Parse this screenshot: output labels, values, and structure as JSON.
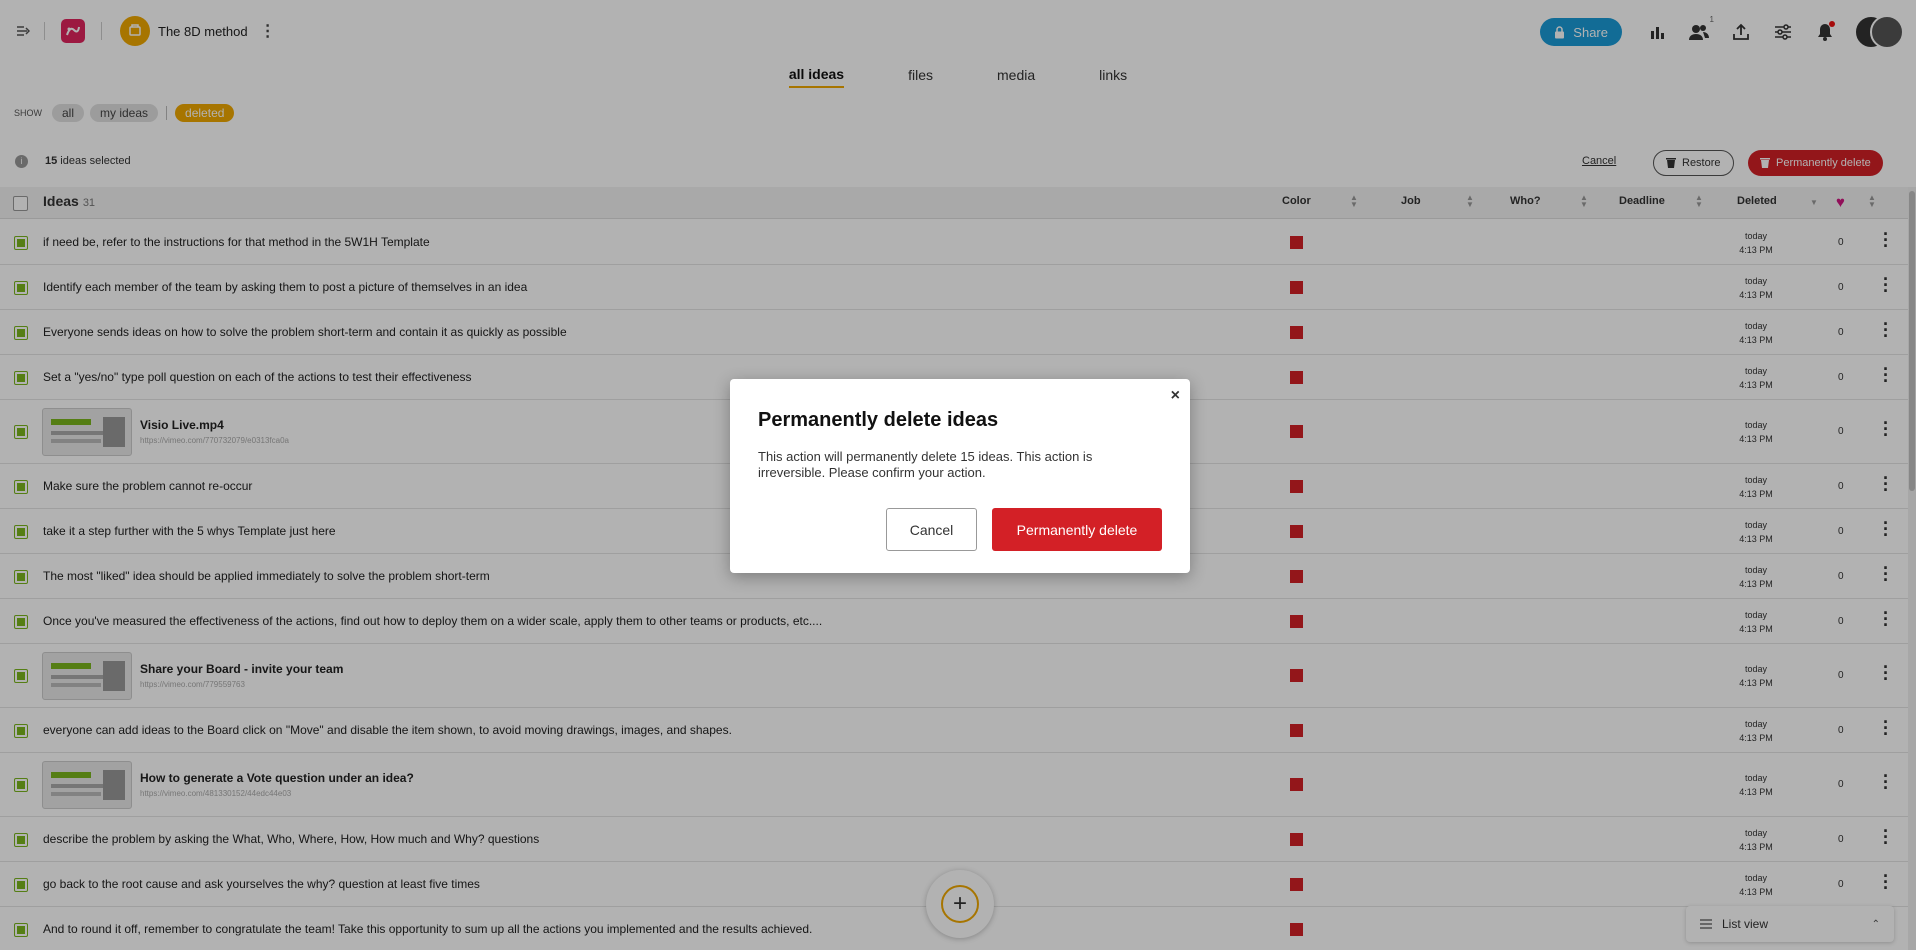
{
  "topbar": {
    "board_name": "The 8D method",
    "share_label": "Share",
    "users_count": "1"
  },
  "tabs": [
    {
      "label": "all ideas",
      "active": true
    },
    {
      "label": "files",
      "active": false
    },
    {
      "label": "media",
      "active": false
    },
    {
      "label": "links",
      "active": false
    }
  ],
  "filters": {
    "show_label": "SHOW",
    "options": [
      {
        "label": "all",
        "active": false
      },
      {
        "label": "my ideas",
        "active": false
      },
      {
        "label": "deleted",
        "active": true
      }
    ]
  },
  "selection": {
    "count": "15",
    "suffix": " ideas selected",
    "cancel_label": "Cancel",
    "restore_label": "Restore",
    "perm_delete_label": "Permanently delete"
  },
  "table": {
    "ideas_label": "Ideas",
    "ideas_count": "31",
    "col_color": "Color",
    "col_job": "Job",
    "col_who": "Who?",
    "col_deadline": "Deadline",
    "col_deleted": "Deleted",
    "rows": [
      {
        "type": "text",
        "text": "if need be, refer to the instructions for that method in the 5W1H Template",
        "deleted_day": "today",
        "deleted_time": "4:13 PM",
        "likes": "0"
      },
      {
        "type": "text",
        "text": "Identify each member of the team by asking them to post a picture of themselves in an idea",
        "deleted_day": "today",
        "deleted_time": "4:13 PM",
        "likes": "0"
      },
      {
        "type": "text",
        "text": "Everyone sends ideas on how to solve the problem short-term and contain it as quickly as possible",
        "deleted_day": "today",
        "deleted_time": "4:13 PM",
        "likes": "0"
      },
      {
        "type": "text",
        "text": "Set a \"yes/no\" type poll question on each of the actions to test their effectiveness",
        "deleted_day": "today",
        "deleted_time": "4:13 PM",
        "likes": "0"
      },
      {
        "type": "media",
        "title": "Visio Live.mp4",
        "url": "https://vimeo.com/770732079/e0313fca0a",
        "deleted_day": "today",
        "deleted_time": "4:13 PM",
        "likes": "0"
      },
      {
        "type": "text",
        "text": "Make sure the problem cannot re-occur",
        "deleted_day": "today",
        "deleted_time": "4:13 PM",
        "likes": "0"
      },
      {
        "type": "text",
        "text": "take it a step further with the 5 whys Template just here",
        "deleted_day": "today",
        "deleted_time": "4:13 PM",
        "likes": "0"
      },
      {
        "type": "text",
        "text": "The most \"liked\" idea should be applied immediately to solve the problem short-term",
        "deleted_day": "today",
        "deleted_time": "4:13 PM",
        "likes": "0"
      },
      {
        "type": "text",
        "text": "Once you've measured the effectiveness of the actions, find out how to deploy them on a wider scale, apply them to other teams or products, etc....",
        "deleted_day": "today",
        "deleted_time": "4:13 PM",
        "likes": "0"
      },
      {
        "type": "media",
        "title": "Share your Board - invite your team",
        "url": "https://vimeo.com/779559763",
        "deleted_day": "today",
        "deleted_time": "4:13 PM",
        "likes": "0"
      },
      {
        "type": "text",
        "text": "everyone can add ideas to the Board click on \"Move\" and disable the item shown, to avoid moving drawings, images, and shapes.",
        "deleted_day": "today",
        "deleted_time": "4:13 PM",
        "likes": "0"
      },
      {
        "type": "media",
        "title": "How to generate a Vote question under an idea?",
        "url": "https://vimeo.com/481330152/44edc44e03",
        "deleted_day": "today",
        "deleted_time": "4:13 PM",
        "likes": "0"
      },
      {
        "type": "text",
        "text": "describe the problem by asking the What, Who, Where, How, How much and Why? questions",
        "deleted_day": "today",
        "deleted_time": "4:13 PM",
        "likes": "0"
      },
      {
        "type": "text",
        "text": "go back to the root cause and ask yourselves the why? question at least five times",
        "deleted_day": "today",
        "deleted_time": "4:13 PM",
        "likes": "0"
      },
      {
        "type": "text",
        "text": "And to round it off, remember to congratulate the team! Take this opportunity to sum up all the actions you implemented and the results achieved.",
        "deleted_day": "today",
        "deleted_time": "4:13 PM",
        "likes": "0"
      }
    ]
  },
  "footer": {
    "list_view_label": "List view"
  },
  "modal": {
    "title": "Permanently delete ideas",
    "body": "This action will permanently delete 15 ideas. This action is irreversible. Please confirm your action.",
    "cancel_label": "Cancel",
    "confirm_label": "Permanently delete",
    "close_glyph": "×"
  },
  "colors": {
    "accent": "#f0a800",
    "danger": "#d32026",
    "share": "#1a9bd7",
    "check": "#7ab51d",
    "idea_color": "#d32026"
  }
}
